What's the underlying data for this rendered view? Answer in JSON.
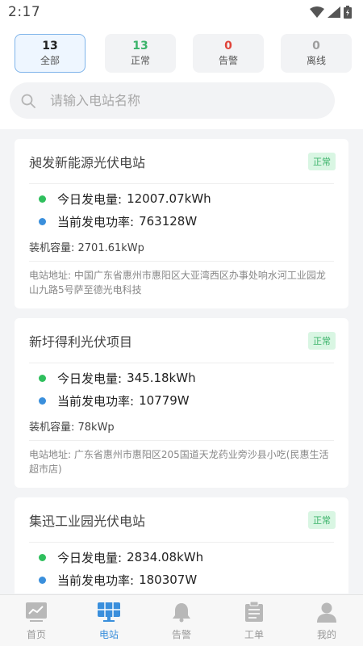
{
  "status": {
    "time": "2:17"
  },
  "tabs": [
    {
      "count": "13",
      "label": "全部",
      "color": "#222222"
    },
    {
      "count": "13",
      "label": "正常",
      "color": "#3bb36a"
    },
    {
      "count": "0",
      "label": "告警",
      "color": "#e0443a"
    },
    {
      "count": "0",
      "label": "离线",
      "color": "#9e9e9e"
    }
  ],
  "search": {
    "placeholder": "请输入电站名称"
  },
  "stations": [
    {
      "name": "昶发新能源光伏电站",
      "status": "正常",
      "energy_label": "今日发电量:",
      "energy_value": "12007.07kWh",
      "power_label": "当前发电功率:",
      "power_value": "763128W",
      "capacity": "装机容量: 2701.61kWp",
      "address": "电站地址: 中国广东省惠州市惠阳区大亚湾西区办事处响水河工业园龙山九路5号萨至德光电科技"
    },
    {
      "name": "新圩得利光伏项目",
      "status": "正常",
      "energy_label": "今日发电量:",
      "energy_value": "345.18kWh",
      "power_label": "当前发电功率:",
      "power_value": "10779W",
      "capacity": "装机容量: 78kWp",
      "address": "电站地址: 广东省惠州市惠阳区205国道天龙药业旁沙县小吃(民惠生活超市店)"
    },
    {
      "name": "集迅工业园光伏电站",
      "status": "正常",
      "energy_label": "今日发电量:",
      "energy_value": "2834.08kWh",
      "power_label": "当前发电功率:",
      "power_value": "180307W",
      "capacity": "",
      "address": ""
    }
  ],
  "nav": [
    {
      "label": "首页",
      "icon": "home-icon"
    },
    {
      "label": "电站",
      "icon": "solar-panel-icon"
    },
    {
      "label": "告警",
      "icon": "bell-icon"
    },
    {
      "label": "工单",
      "icon": "clipboard-icon"
    },
    {
      "label": "我的",
      "icon": "user-icon"
    }
  ],
  "colors": {
    "accent": "#3a8fdc",
    "ok": "#3bb36a",
    "energy_dot": "#2fbf5d",
    "power_dot": "#3a8fdc"
  }
}
